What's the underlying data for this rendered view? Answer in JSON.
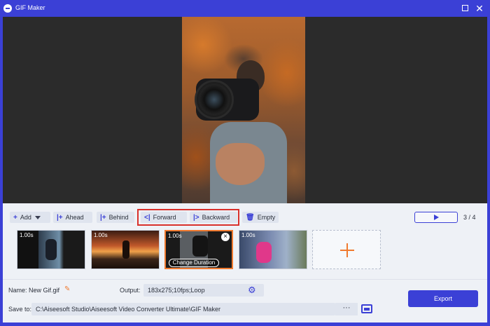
{
  "window": {
    "title": "GIF Maker"
  },
  "toolbar": {
    "add_label": "Add",
    "ahead_label": "Ahead",
    "behind_label": "Behind",
    "forward_label": "Forward",
    "backward_label": "Backward",
    "empty_label": "Empty"
  },
  "playback": {
    "counter": "3 / 4"
  },
  "frames": [
    {
      "duration": "1.00s"
    },
    {
      "duration": "1.00s"
    },
    {
      "duration": "1.00s",
      "selected": true,
      "change_label": "Change Duration"
    },
    {
      "duration": "1.00s"
    }
  ],
  "form": {
    "name_label": "Name:",
    "name_value": "New Gif.gif",
    "output_label": "Output:",
    "output_value": "183x275;10fps;Loop",
    "save_label": "Save to:",
    "save_path": "C:\\Aiseesoft Studio\\Aiseesoft Video Converter Ultimate\\GIF Maker",
    "browse_label": "···",
    "export_label": "Export"
  },
  "colors": {
    "accent": "#3b40d6",
    "highlight": "#d9302b",
    "frame_selected": "#f07a2f"
  }
}
